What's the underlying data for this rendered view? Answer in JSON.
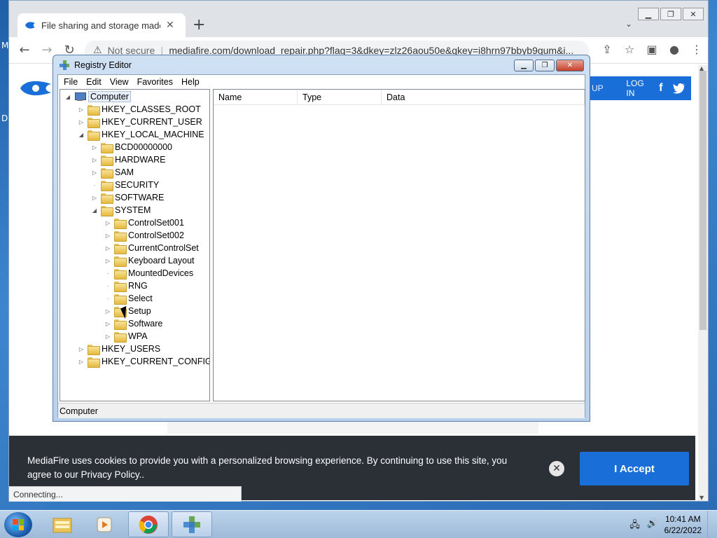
{
  "desktop": {
    "letters": [
      "M",
      "D"
    ]
  },
  "browser": {
    "tab_title": "File sharing and storage made si",
    "tab_close": "✕",
    "new_tab": "+",
    "security_label": "Not secure",
    "url": "mediafire.com/download_repair.php?flag=3&dkey=zlz26aou50e&qkey=i8hrn97bbyb9gum&i...",
    "status": "Connecting..."
  },
  "mediafire": {
    "header_partial": "UP",
    "login_label": "LOG IN",
    "facebook": "f",
    "twitter": "t"
  },
  "cookie": {
    "text": "MediaFire uses cookies to provide you with a personalized browsing experience. By continuing to use this site, you agree to our Privacy Policy..",
    "accept_label": "I Accept",
    "close_label": "✕"
  },
  "regedit": {
    "title": "Registry Editor",
    "menu": [
      "File",
      "Edit",
      "View",
      "Favorites",
      "Help"
    ],
    "columns": [
      "Name",
      "Type",
      "Data"
    ],
    "status": "Computer",
    "tree": {
      "root": "Computer",
      "hives": [
        "HKEY_CLASSES_ROOT",
        "HKEY_CURRENT_USER",
        "HKEY_LOCAL_MACHINE",
        "HKEY_USERS",
        "HKEY_CURRENT_CONFIG"
      ],
      "hklm_children": [
        "BCD00000000",
        "HARDWARE",
        "SAM",
        "SECURITY",
        "SOFTWARE",
        "SYSTEM"
      ],
      "system_children": [
        "ControlSet001",
        "ControlSet002",
        "CurrentControlSet",
        "Keyboard Layout",
        "MountedDevices",
        "RNG",
        "Select",
        "Setup",
        "Software",
        "WPA"
      ]
    }
  },
  "taskbar": {
    "time": "10:41 AM",
    "date": "6/22/2022"
  },
  "colors": {
    "accent": "#1a6ed8",
    "cookie_bg": "#2b2f36"
  }
}
